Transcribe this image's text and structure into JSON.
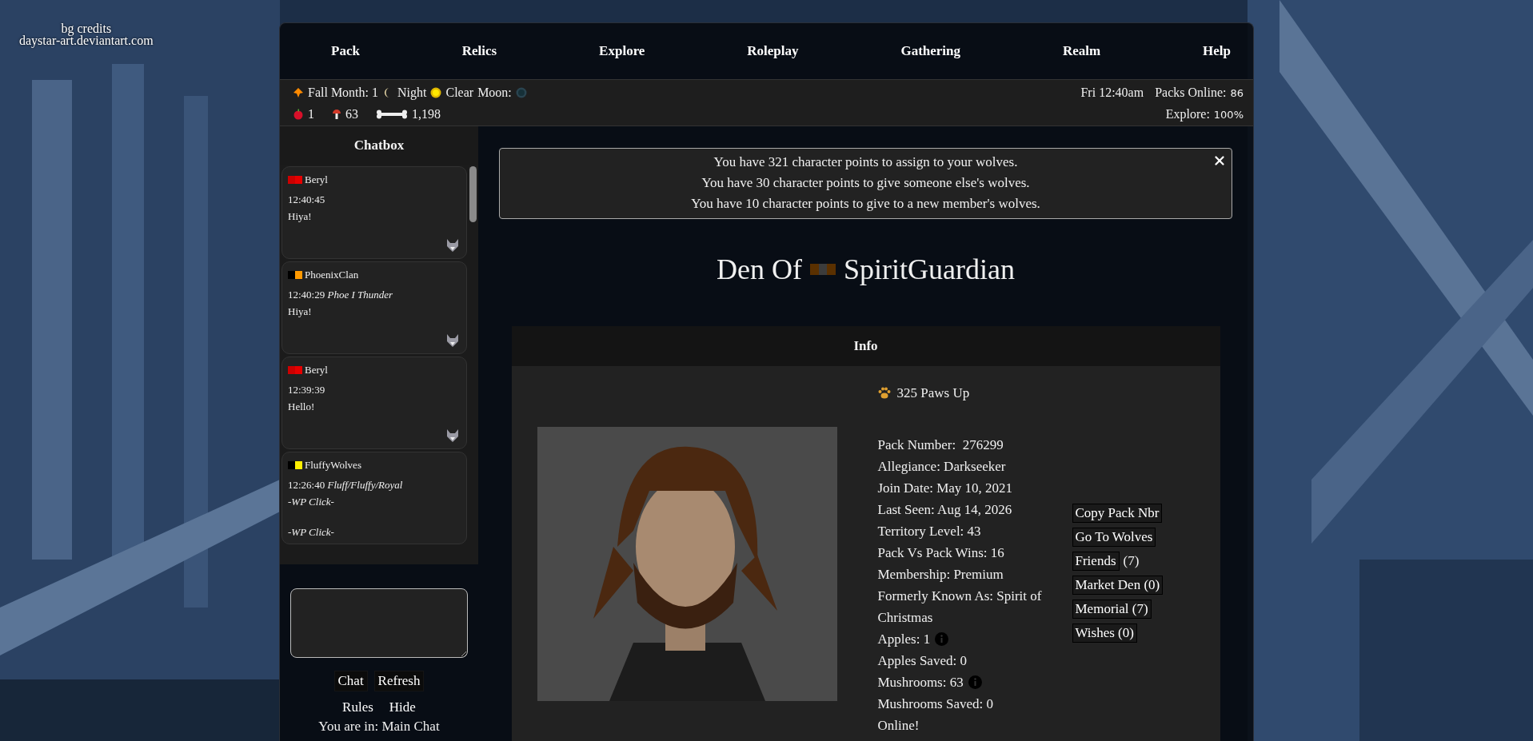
{
  "bg_credits": [
    "bg credits",
    "daystar-art.deviantart.com"
  ],
  "nav": [
    "Pack",
    "Relics",
    "Explore",
    "Roleplay",
    "Gathering",
    "Realm",
    "Help"
  ],
  "status": {
    "season": "Fall Month: 1",
    "time_of_day": "Night",
    "weather": "Clear",
    "moon_label": "Moon:",
    "clock": "Fri 12:40am",
    "packs_online_label": "Packs Online:",
    "packs_online": "86",
    "apples": "1",
    "mushrooms": "63",
    "bones": "1,198",
    "explore_label": "Explore:",
    "explore": "100%"
  },
  "chatbox": {
    "title": "Chatbox",
    "messages": [
      {
        "name": "Beryl",
        "flag": [
          {
            "color": "#cc0000"
          },
          {
            "color": "#e60000"
          }
        ],
        "time": "12:40:45",
        "paragraphs": [
          "Hiya!"
        ],
        "italic": false,
        "has_icon": true
      },
      {
        "name": "PhoenixClan",
        "flag": [
          {
            "color": "#000000"
          },
          {
            "color": "#ff9900"
          }
        ],
        "time": "12:40:29",
        "character": "Phoe I Thunder",
        "paragraphs": [
          "Hiya!"
        ],
        "italic": false,
        "has_icon": true
      },
      {
        "name": "Beryl",
        "flag": [
          {
            "color": "#cc0000"
          },
          {
            "color": "#e60000"
          }
        ],
        "time": "12:39:39",
        "paragraphs": [
          "Hello!"
        ],
        "italic": false,
        "has_icon": true
      },
      {
        "name": "FluffyWolves",
        "flag": [
          {
            "color": "#000000"
          },
          {
            "color": "#ffee00"
          }
        ],
        "time": "12:26:40",
        "character": "Fluff/Fluffy/Royal",
        "paragraphs": [
          "-WP Click-",
          "-WP Click-"
        ],
        "italic": true,
        "has_icon": false
      }
    ],
    "buttons": [
      "Chat",
      "Refresh"
    ],
    "links": [
      "Rules",
      "Hide"
    ],
    "location": "You are in: Main Chat"
  },
  "notice": {
    "lines": [
      "You have 321 character points to assign to your wolves.",
      "You have 30 character points to give someone else's wolves.",
      "You have 10 character points to give to a new member's wolves."
    ]
  },
  "title": {
    "prefix": "Den Of",
    "flag": [
      {
        "color": "#5a3000"
      },
      {
        "color": "#3c3c3c"
      },
      {
        "color": "#5a3000"
      }
    ],
    "name": "SpiritGuardian"
  },
  "info": {
    "header": "Info",
    "paws": "325 Paws Up",
    "fields": [
      {
        "text": "Pack Number:  276299",
        "info": false
      },
      {
        "text": "Allegiance: Darkseeker",
        "info": false
      },
      {
        "text": "Join Date: May 10, 2021",
        "info": false
      },
      {
        "text": "Last Seen: Aug 14, 2026",
        "info": false
      },
      {
        "text": "Territory Level: 43",
        "info": false
      },
      {
        "text": "Pack Vs Pack Wins: 16",
        "info": false
      },
      {
        "text": "Membership: Premium",
        "info": false
      },
      {
        "text": "Formerly Known As: Spirit of Christmas",
        "info": false
      },
      {
        "text": "Apples: 1",
        "info": true
      },
      {
        "text": "Apples Saved: 0",
        "info": false
      },
      {
        "text": "Mushrooms: 63",
        "info": true
      },
      {
        "text": "Mushrooms Saved: 0",
        "info": false
      },
      {
        "text": "Online!",
        "info": false
      }
    ],
    "buttons": [
      {
        "label": "Copy Pack Nbr"
      },
      {
        "label": "Go To Wolves"
      },
      {
        "label": "Friends",
        "suffix": "(7)"
      },
      {
        "label": "Market Den (0)"
      },
      {
        "label": "Memorial (7)"
      },
      {
        "label": "Wishes (0)"
      }
    ]
  }
}
